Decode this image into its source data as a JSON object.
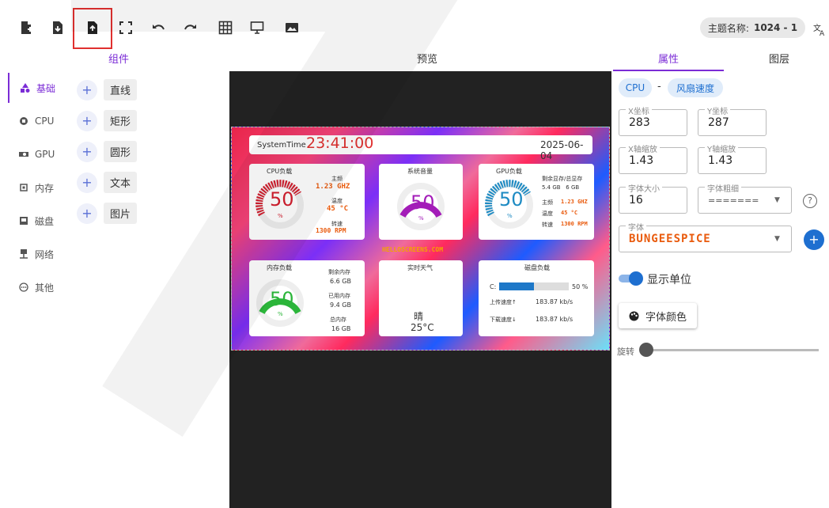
{
  "toolbar": {
    "theme_label": "主题名称:",
    "theme_value": "1024 - 1"
  },
  "tabs": [
    "组件",
    "预览",
    "属性",
    "图层"
  ],
  "sidebar": {
    "categories": [
      "基础",
      "CPU",
      "GPU",
      "内存",
      "磁盘",
      "网络",
      "其他"
    ],
    "components": [
      "直线",
      "矩形",
      "圆形",
      "文本",
      "图片"
    ]
  },
  "preview": {
    "system_time_label": "SystemTime",
    "time": "23:41:00",
    "date": "2025-06-04",
    "site": "HELLOSCREENS.COM",
    "cpu": {
      "title": "CPU负载",
      "value": "50",
      "unit": "%",
      "freq_label": "主频",
      "freq": "1.23 GHZ",
      "temp_label": "温度",
      "temp": "45 °C",
      "fan_label": "转速",
      "fan": "1300 RPM"
    },
    "volume": {
      "title": "系统音量",
      "value": "50",
      "unit": "%"
    },
    "gpu": {
      "title": "GPU负载",
      "value": "50",
      "unit": "%",
      "vram_label": "剩余显存/总显存",
      "vram": "5.4 GB   6 GB",
      "freq_label": "主频",
      "freq": "1.23 GHZ",
      "temp_label": "温度",
      "temp": "45 °C",
      "fan_label": "转速",
      "fan": "1300 RPM"
    },
    "memory": {
      "title": "内存负载",
      "value": "50",
      "unit": "%",
      "free_label": "剩余内存",
      "free": "6.6 GB",
      "used_label": "已用内存",
      "used": "9.4 GB",
      "total_label": "总内存",
      "total": "16 GB"
    },
    "weather": {
      "title": "实时天气",
      "condition": "晴",
      "temp": "25°C"
    },
    "disk": {
      "title": "磁盘负载",
      "drive": "C:",
      "percent": "50 %",
      "level": 0.5,
      "up_label": "上传速度↑",
      "up": "183.87 kb/s",
      "down_label": "下载速度↓",
      "down": "183.87 kb/s"
    }
  },
  "properties": {
    "chip_left": "CPU",
    "chip_sep": "-",
    "chip_right": "风扇速度",
    "x_label": "X坐标",
    "x": "283",
    "y_label": "Y坐标",
    "y": "287",
    "xs_label": "X轴缩放",
    "xs": "1.43",
    "ys_label": "Y轴缩放",
    "ys": "1.43",
    "size_label": "字体大小",
    "size": "16",
    "weight_label": "字体粗细",
    "weight": "=======",
    "font_label": "字体",
    "font": "BUNGEESPICE",
    "unit_toggle": "显示单位",
    "color_btn": "字体颜色",
    "rotate_label": "旋转"
  },
  "colors": {
    "accent": "#7b2cd6",
    "blue": "#1e6fd0",
    "highlight": "#e0302f"
  }
}
